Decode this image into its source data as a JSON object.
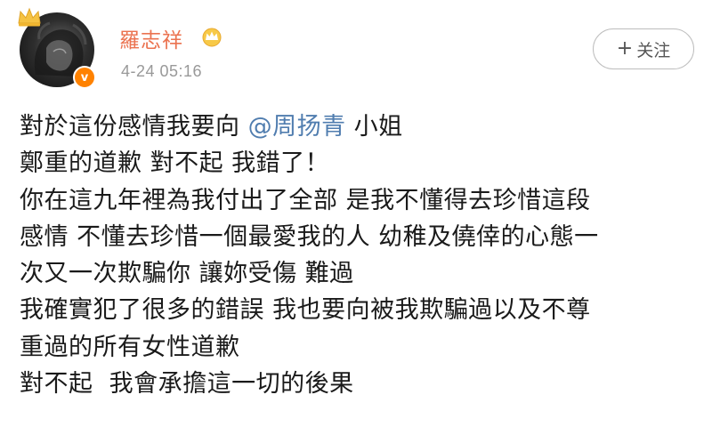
{
  "author": {
    "name": "羅志祥",
    "time": "4-24 05:16",
    "verified_badge_letter": "v",
    "vip_icon": "crown-icon",
    "avatar_badge_icon": "crown-icon",
    "name_color": "#eb7350"
  },
  "follow_button": {
    "plus": "+",
    "label": "关注"
  },
  "post": {
    "line1_prefix": "對於這份感情我要向 ",
    "mention": "@周扬青",
    "line1_suffix": " 小姐",
    "lines": [
      "鄭重的道歉 對不起 我錯了！",
      "你在這九年裡為我付出了全部 是我不懂得去珍惜這段",
      "感情 不懂去珍惜一個最愛我的人 幼稚及僥倖的心態一",
      "次又一次欺騙你 讓妳受傷 難過",
      "我確實犯了很多的錯誤 我也要向被我欺騙過以及不尊",
      "重過的所有女性道歉",
      "對不起  我會承擔這一切的後果"
    ],
    "mention_color": "#507daf"
  }
}
